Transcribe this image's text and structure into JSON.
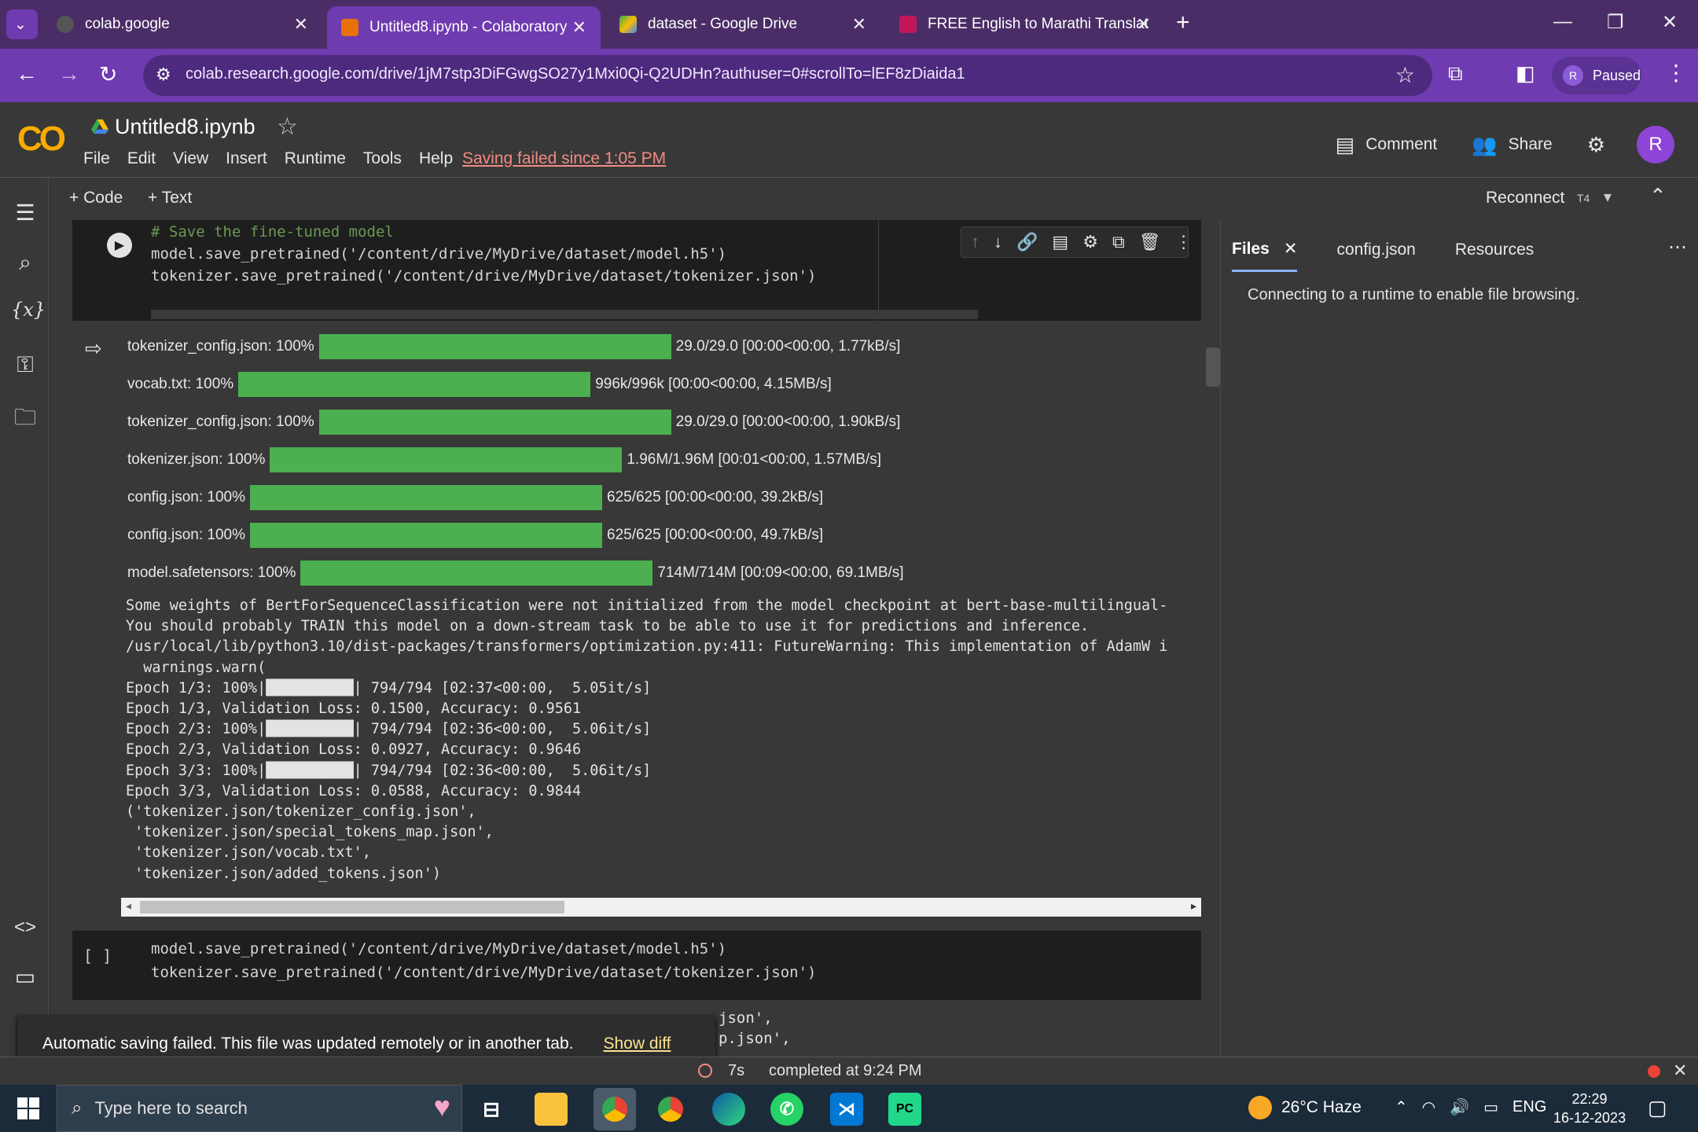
{
  "browser": {
    "tabs": [
      {
        "title": "colab.google",
        "active": false
      },
      {
        "title": "Untitled8.ipynb - Colaboratory",
        "active": true
      },
      {
        "title": "dataset - Google Drive",
        "active": false
      },
      {
        "title": "FREE English to Marathi Translat",
        "active": false
      }
    ],
    "url": "colab.research.google.com/drive/1jM7stp3DiFGwgSO27y1Mxi0Qi-Q2UDHn?authuser=0#scrollTo=lEF8zDiaida1",
    "profile_initial": "R",
    "profile_status": "Paused",
    "accent_color": "#6f3bb0"
  },
  "colab": {
    "logo": "CO",
    "notebook_title": "Untitled8.ipynb",
    "menus": [
      "File",
      "Edit",
      "View",
      "Insert",
      "Runtime",
      "Tools",
      "Help"
    ],
    "saving_status": "Saving failed since 1:05 PM",
    "comment_label": "Comment",
    "share_label": "Share",
    "user_initial": "R"
  },
  "toolbar": {
    "add_code": "+ Code",
    "add_text": "+ Text",
    "reconnect": "Reconnect",
    "runtime_type": "T4"
  },
  "cell1": {
    "code": [
      "# Save the fine-tuned model",
      "model.save_pretrained('/content/drive/MyDrive/dataset/model.h5')",
      "tokenizer.save_pretrained('/content/drive/MyDrive/dataset/tokenizer.json')"
    ]
  },
  "output": {
    "progress": [
      {
        "label": "tokenizer_config.json: 100%",
        "stats": "29.0/29.0 [00:00<00:00, 1.77kB/s]",
        "value": 100
      },
      {
        "label": "vocab.txt: 100%",
        "stats": "996k/996k [00:00<00:00, 4.15MB/s]",
        "value": 100
      },
      {
        "label": "tokenizer_config.json: 100%",
        "stats": "29.0/29.0 [00:00<00:00, 1.90kB/s]",
        "value": 100
      },
      {
        "label": "tokenizer.json: 100%",
        "stats": "1.96M/1.96M [00:01<00:00, 1.57MB/s]",
        "value": 100
      },
      {
        "label": "config.json: 100%",
        "stats": "625/625 [00:00<00:00, 39.2kB/s]",
        "value": 100
      },
      {
        "label": "config.json: 100%",
        "stats": "625/625 [00:00<00:00, 49.7kB/s]",
        "value": 100
      },
      {
        "label": "model.safetensors: 100%",
        "stats": "714M/714M [00:09<00:00, 69.1MB/s]",
        "value": 100
      }
    ],
    "log": [
      "Some weights of BertForSequenceClassification were not initialized from the model checkpoint at bert-base-multilingual-",
      "You should probably TRAIN this model on a down-stream task to be able to use it for predictions and inference.",
      "/usr/local/lib/python3.10/dist-packages/transformers/optimization.py:411: FutureWarning: This implementation of AdamW i",
      "  warnings.warn(",
      "Epoch 1/3: 100%|██████████| 794/794 [02:37<00:00,  5.05it/s]",
      "Epoch 1/3, Validation Loss: 0.1500, Accuracy: 0.9561",
      "Epoch 2/3: 100%|██████████| 794/794 [02:36<00:00,  5.06it/s]",
      "Epoch 2/3, Validation Loss: 0.0927, Accuracy: 0.9646",
      "Epoch 3/3: 100%|██████████| 794/794 [02:36<00:00,  5.06it/s]",
      "Epoch 3/3, Validation Loss: 0.0588, Accuracy: 0.9844",
      "('tokenizer.json/tokenizer_config.json',",
      " 'tokenizer.json/special_tokens_map.json',",
      " 'tokenizer.json/vocab.txt',",
      " 'tokenizer.json/added_tokens.json')"
    ]
  },
  "cell2": {
    "bracket": "[ ]",
    "code": [
      "model.save_pretrained('/content/drive/MyDrive/dataset/model.h5')",
      "tokenizer.save_pretrained('/content/drive/MyDrive/dataset/tokenizer.json')"
    ],
    "partial_output": [
      "json',",
      "p.json',"
    ]
  },
  "right_panel": {
    "tabs": [
      "Files",
      "config.json",
      "Resources"
    ],
    "message": "Connecting to a runtime to enable file browsing."
  },
  "snackbar": {
    "message": "Automatic saving failed. This file was updated remotely or in another tab.",
    "action": "Show diff"
  },
  "statusbar": {
    "elapsed": "7s",
    "completed": "completed at 9:24 PM"
  },
  "taskbar": {
    "search_placeholder": "Type here to search",
    "weather": "26°C  Haze",
    "language": "ENG",
    "time": "22:29",
    "date": "16-12-2023"
  }
}
